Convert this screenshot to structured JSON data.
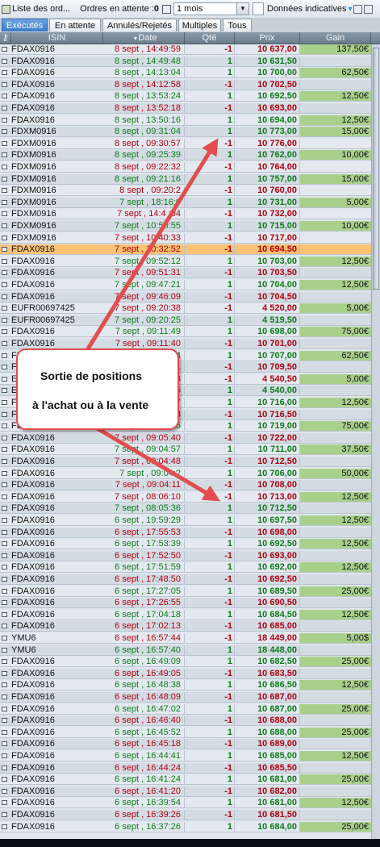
{
  "toolbar": {
    "orders_list_label": "Liste des ord...",
    "pending_label": "Ordres en attente :",
    "pending_count": "0",
    "period_value": "1 mois",
    "indicative_label": "Données indicatives"
  },
  "tabs": [
    {
      "label": "Exécutés",
      "active": true
    },
    {
      "label": "En attente",
      "active": false
    },
    {
      "label": "Annulés/Rejetés",
      "active": false
    },
    {
      "label": "Multiples",
      "active": false
    },
    {
      "label": "Tous",
      "active": false
    }
  ],
  "columns": [
    "ISIN",
    "Date",
    "Qté",
    "Prix",
    "Gain"
  ],
  "colors": {
    "buy": "#0e7a1a",
    "sell": "#b00010",
    "gain_bg": "#a9d08b",
    "selected_row": "#f9c275",
    "annotation": "#e24d4d"
  },
  "rows": [
    {
      "isin": "FDAX0916",
      "date": "8 sept , 14:49:59",
      "qte": "-1",
      "prix": "10 637,00",
      "gain": "137,50€"
    },
    {
      "isin": "FDAX0916",
      "date": "8 sept , 14:49:48",
      "qte": "1",
      "prix": "10 631,50",
      "gain": ""
    },
    {
      "isin": "FDAX0916",
      "date": "8 sept , 14:13:04",
      "qte": "1",
      "prix": "10 700,00",
      "gain": "62,50€"
    },
    {
      "isin": "FDAX0916",
      "date": "8 sept , 14:12:58",
      "qte": "-1",
      "prix": "10 702,50",
      "gain": ""
    },
    {
      "isin": "FDAX0916",
      "date": "8 sept , 13:53:24",
      "qte": "1",
      "prix": "10 692,50",
      "gain": "12,50€"
    },
    {
      "isin": "FDAX0916",
      "date": "8 sept , 13:52:18",
      "qte": "-1",
      "prix": "10 693,00",
      "gain": ""
    },
    {
      "isin": "FDAX0916",
      "date": "8 sept , 13:50:16",
      "qte": "1",
      "prix": "10 694,00",
      "gain": "12,50€"
    },
    {
      "isin": "FDXM0916",
      "date": "8 sept , 09:31:04",
      "qte": "1",
      "prix": "10 773,00",
      "gain": "15,00€"
    },
    {
      "isin": "FDXM0916",
      "date": "8 sept , 09:30:57",
      "qte": "-1",
      "prix": "10 776,00",
      "gain": ""
    },
    {
      "isin": "FDXM0916",
      "date": "8 sept , 09:25:39",
      "qte": "1",
      "prix": "10 762,00",
      "gain": "10,00€"
    },
    {
      "isin": "FDXM0916",
      "date": "8 sept , 09:22:32",
      "qte": "-1",
      "prix": "10 764,00",
      "gain": ""
    },
    {
      "isin": "FDXM0916",
      "date": "8 sept , 09:21:16",
      "qte": "1",
      "prix": "10 757,00",
      "gain": "15,00€"
    },
    {
      "isin": "FDXM0916",
      "date": "8 sept , 09:20:2",
      "qte": "-1",
      "prix": "10 760,00",
      "gain": ""
    },
    {
      "isin": "FDXM0916",
      "date": "7 sept , 18:16:0",
      "qte": "1",
      "prix": "10 731,00",
      "gain": "5,00€"
    },
    {
      "isin": "FDXM0916",
      "date": "7 sept , 14:4 :04",
      "qte": "-1",
      "prix": "10 732,00",
      "gain": ""
    },
    {
      "isin": "FDXM0916",
      "date": "7 sept , 10:50:55",
      "qte": "1",
      "prix": "10 715,00",
      "gain": "10,00€"
    },
    {
      "isin": "FDXM0916",
      "date": "7 sept , 10:40:33",
      "qte": "-1",
      "prix": "10 717,00",
      "gain": ""
    },
    {
      "isin": "FDAX0916",
      "date": "7 sept , 10:32:52",
      "qte": "-1",
      "prix": "10 694,50",
      "gain": "",
      "selected": true
    },
    {
      "isin": "FDAX0916",
      "date": "7 sept , 09:52:12",
      "qte": "1",
      "prix": "10 703,00",
      "gain": "12,50€"
    },
    {
      "isin": "FDAX0916",
      "date": "7 sept , 09:51:31",
      "qte": "-1",
      "prix": "10 703,50",
      "gain": ""
    },
    {
      "isin": "FDAX0916",
      "date": "7 sept , 09:47:21",
      "qte": "1",
      "prix": "10 704,00",
      "gain": "12,50€"
    },
    {
      "isin": "FDAX0916",
      "date": "7 sept , 09:46:09",
      "qte": "-1",
      "prix": "10 704,50",
      "gain": ""
    },
    {
      "isin": "EUFR00697425",
      "date": "7 sept , 09:20:38",
      "qte": "-1",
      "prix": "4 520,00",
      "gain": "5,00€"
    },
    {
      "isin": "EUFR00697425",
      "date": "7 sept , 09:20:25",
      "qte": "1",
      "prix": "4 519,50",
      "gain": ""
    },
    {
      "isin": "FDAX0916",
      "date": "7 sept , 09:11:49",
      "qte": "1",
      "prix": "10 698,00",
      "gain": "75,00€"
    },
    {
      "isin": "FDAX0916",
      "date": "7 sept , 09:11:40",
      "qte": "-1",
      "prix": "10 701,00",
      "gain": ""
    },
    {
      "isin": "FDAX0916",
      "date": "7 sept , 09:11:04",
      "qte": "1",
      "prix": "10 707,00",
      "gain": "62,50€"
    },
    {
      "isin": "FDAX0916",
      "date": "7 sept , 09:10:51",
      "qte": "-1",
      "prix": "10 709,50",
      "gain": ""
    },
    {
      "isin": "EUFR00697425",
      "date": "7 sept , 09:10:16",
      "qte": "-1",
      "prix": "4 540,50",
      "gain": "5,00€"
    },
    {
      "isin": "EUFR00697425",
      "date": "7 sept , 09:10:05",
      "qte": "1",
      "prix": "4 540,00",
      "gain": ""
    },
    {
      "isin": "FDAX0916",
      "date": "7 sept , 09:08:27",
      "qte": "1",
      "prix": "10 716,00",
      "gain": "12,50€"
    },
    {
      "isin": "FDAX0916",
      "date": "7 sept , 09:07:13",
      "qte": "-1",
      "prix": "10 716,50",
      "gain": ""
    },
    {
      "isin": "FDAX0916",
      "date": "7 sept , 09:05:55",
      "qte": "1",
      "prix": "10 719,00",
      "gain": "75,00€"
    },
    {
      "isin": "FDAX0916",
      "date": "7 sept , 09:05:40",
      "qte": "-1",
      "prix": "10 722,00",
      "gain": ""
    },
    {
      "isin": "FDAX0916",
      "date": "7 sept , 09:04:57",
      "qte": "1",
      "prix": "10 711,00",
      "gain": "37,50€"
    },
    {
      "isin": "FDAX0916",
      "date": "7 sept , 09:04:48",
      "qte": "-1",
      "prix": "10 712,50",
      "gain": ""
    },
    {
      "isin": "FDAX0916",
      "date": "7 sept , 09:04:2",
      "qte": "1",
      "prix": "10 706,00",
      "gain": "50,00€"
    },
    {
      "isin": "FDAX0916",
      "date": "7 sept , 09:04:11",
      "qte": "-1",
      "prix": "10 708,00",
      "gain": ""
    },
    {
      "isin": "FDAX0916",
      "date": "7 sept , 08:06:10",
      "qte": "-1",
      "prix": "10 713,00",
      "gain": "12,50€"
    },
    {
      "isin": "FDAX0916",
      "date": "7 sept , 08:05:36",
      "qte": "1",
      "prix": "10 712,50",
      "gain": ""
    },
    {
      "isin": "FDAX0916",
      "date": "6 sept , 19:59:29",
      "qte": "1",
      "prix": "10 697,50",
      "gain": "12,50€"
    },
    {
      "isin": "FDAX0916",
      "date": "6 sept , 17:55:53",
      "qte": "-1",
      "prix": "10 698,00",
      "gain": ""
    },
    {
      "isin": "FDAX0916",
      "date": "6 sept , 17:53:39",
      "qte": "1",
      "prix": "10 692,50",
      "gain": "12,50€"
    },
    {
      "isin": "FDAX0916",
      "date": "6 sept , 17:52:50",
      "qte": "-1",
      "prix": "10 693,00",
      "gain": ""
    },
    {
      "isin": "FDAX0916",
      "date": "6 sept , 17:51:59",
      "qte": "1",
      "prix": "10 692,00",
      "gain": "12,50€"
    },
    {
      "isin": "FDAX0916",
      "date": "6 sept , 17:48:50",
      "qte": "-1",
      "prix": "10 692,50",
      "gain": ""
    },
    {
      "isin": "FDAX0916",
      "date": "6 sept , 17:27:05",
      "qte": "1",
      "prix": "10 689,50",
      "gain": "25,00€"
    },
    {
      "isin": "FDAX0916",
      "date": "6 sept , 17:26:55",
      "qte": "-1",
      "prix": "10 690,50",
      "gain": ""
    },
    {
      "isin": "FDAX0916",
      "date": "6 sept , 17:04:18",
      "qte": "1",
      "prix": "10 684,50",
      "gain": "12,50€"
    },
    {
      "isin": "FDAX0916",
      "date": "6 sept , 17:02:13",
      "qte": "-1",
      "prix": "10 685,00",
      "gain": ""
    },
    {
      "isin": "YMU6",
      "date": "6 sept , 16:57:44",
      "qte": "-1",
      "prix": "18 449,00",
      "gain": "5,00$"
    },
    {
      "isin": "YMU6",
      "date": "6 sept , 16:57:40",
      "qte": "1",
      "prix": "18 448,00",
      "gain": ""
    },
    {
      "isin": "FDAX0916",
      "date": "6 sept , 16:49:09",
      "qte": "1",
      "prix": "10 682,50",
      "gain": "25,00€"
    },
    {
      "isin": "FDAX0916",
      "date": "6 sept , 16:49:05",
      "qte": "-1",
      "prix": "10 683,50",
      "gain": ""
    },
    {
      "isin": "FDAX0916",
      "date": "6 sept , 16:48:38",
      "qte": "1",
      "prix": "10 686,50",
      "gain": "12,50€"
    },
    {
      "isin": "FDAX0916",
      "date": "6 sept , 16:48:09",
      "qte": "-1",
      "prix": "10 687,00",
      "gain": ""
    },
    {
      "isin": "FDAX0916",
      "date": "6 sept , 16:47:02",
      "qte": "1",
      "prix": "10 687,00",
      "gain": "25,00€"
    },
    {
      "isin": "FDAX0916",
      "date": "6 sept , 16:46:40",
      "qte": "-1",
      "prix": "10 688,00",
      "gain": ""
    },
    {
      "isin": "FDAX0916",
      "date": "6 sept , 16:45:52",
      "qte": "1",
      "prix": "10 688,00",
      "gain": "25,00€"
    },
    {
      "isin": "FDAX0916",
      "date": "6 sept , 16:45:18",
      "qte": "-1",
      "prix": "10 689,00",
      "gain": ""
    },
    {
      "isin": "FDAX0916",
      "date": "6 sept , 16:44:41",
      "qte": "1",
      "prix": "10 685,00",
      "gain": "12,50€"
    },
    {
      "isin": "FDAX0916",
      "date": "6 sept , 16:44:24",
      "qte": "-1",
      "prix": "10 685,50",
      "gain": ""
    },
    {
      "isin": "FDAX0916",
      "date": "6 sept , 16:41:24",
      "qte": "1",
      "prix": "10 681,00",
      "gain": "25,00€"
    },
    {
      "isin": "FDAX0916",
      "date": "6 sept , 16:41:20",
      "qte": "-1",
      "prix": "10 682,00",
      "gain": ""
    },
    {
      "isin": "FDAX0916",
      "date": "6 sept , 16:39:54",
      "qte": "1",
      "prix": "10 681,00",
      "gain": "12,50€"
    },
    {
      "isin": "FDAX0916",
      "date": "6 sept , 16:39:26",
      "qte": "-1",
      "prix": "10 681,50",
      "gain": ""
    },
    {
      "isin": "FDAX0916",
      "date": "6 sept , 16:37:26",
      "qte": "1",
      "prix": "10 684,00",
      "gain": "25,00€"
    }
  ],
  "annotation": {
    "line1": "Sortie de positions",
    "line2": "à l'achat ou à la vente"
  }
}
